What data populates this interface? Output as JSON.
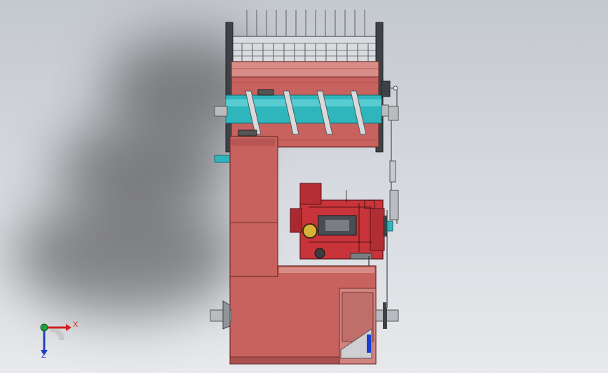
{
  "viewport": {
    "background_top": "#c4c8cf",
    "background_bottom": "#e7e9ec"
  },
  "model": {
    "housing_color": "#c8625e",
    "housing_dark": "#8a3b38",
    "auger_color": "#2fb6bd",
    "engine_color": "#c8343a",
    "shaft_color": "#b8bcc0",
    "linkage_color": "#9aa0a6"
  },
  "triad": {
    "x_label": "X",
    "z_label": "Z",
    "x_color": "#d02020",
    "y_color": "#20a040",
    "z_color": "#2040c0"
  }
}
